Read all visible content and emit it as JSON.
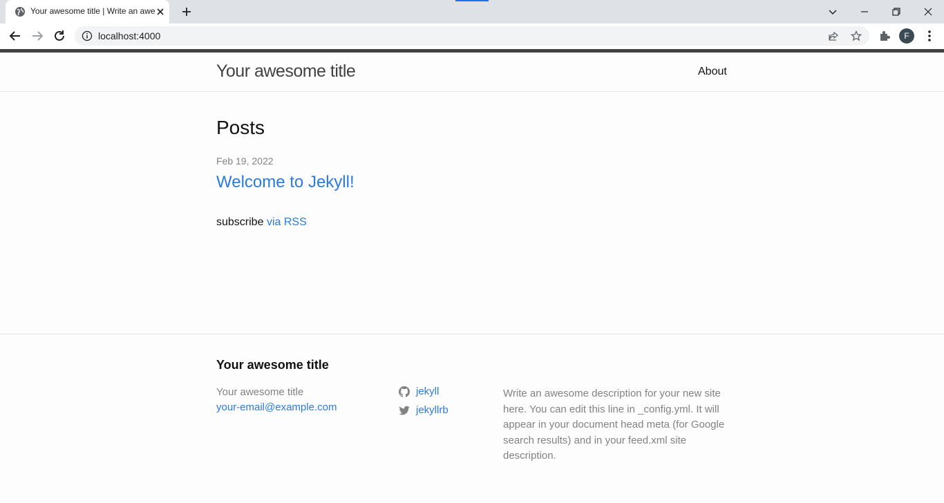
{
  "browser": {
    "tab_title": "Your awesome title | Write an awesome description for your new site",
    "url": "localhost:4000",
    "profile_initial": "F"
  },
  "header": {
    "site_title": "Your awesome title",
    "nav": [
      "About"
    ]
  },
  "main": {
    "heading": "Posts",
    "posts": [
      {
        "date": "Feb 19, 2022",
        "title": "Welcome to Jekyll!"
      }
    ],
    "subscribe_text": "subscribe",
    "subscribe_link": "via RSS"
  },
  "footer": {
    "heading": "Your awesome title",
    "name": "Your awesome title",
    "email": "your-email@example.com",
    "social": [
      {
        "icon": "github-icon",
        "label": "jekyll"
      },
      {
        "icon": "twitter-icon",
        "label": "jekyllrb"
      }
    ],
    "description": "Write an awesome description for your new site here. You can edit this line in _config.yml. It will appear in your document head meta (for Google search results) and in your feed.xml site description."
  }
}
